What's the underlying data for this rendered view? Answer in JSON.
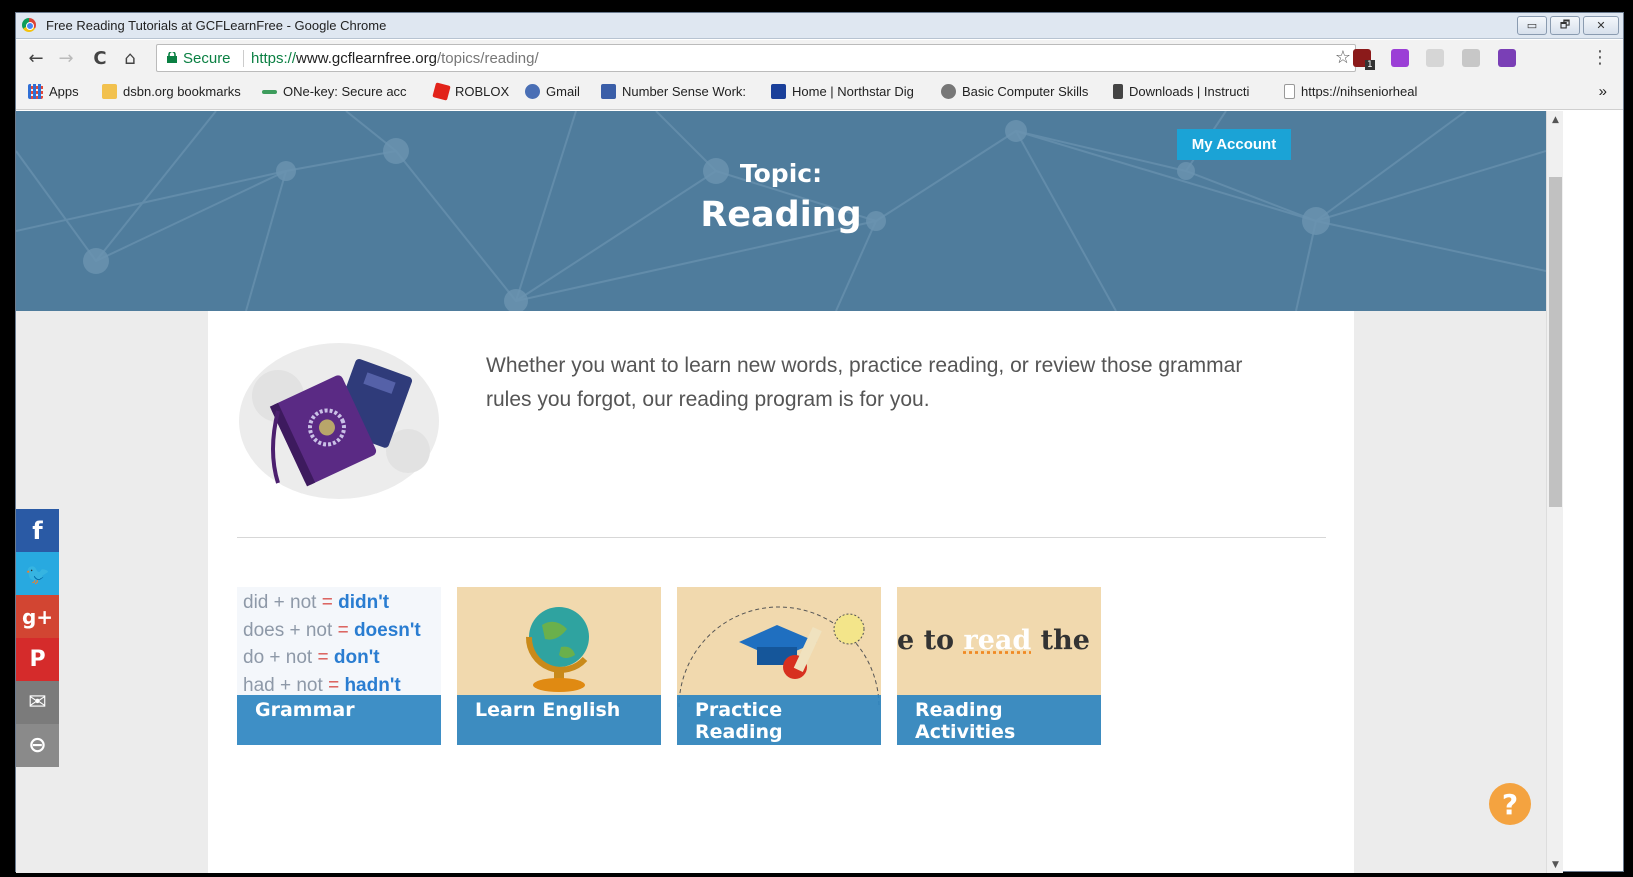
{
  "browser": {
    "window_title": "Free Reading Tutorials at GCFLearnFree - Google Chrome",
    "secure_label": "Secure",
    "url_scheme": "https://",
    "url_host": "www.gcflearnfree.org",
    "url_path": "/topics/reading/",
    "buttons": {
      "back": "←",
      "forward": "→",
      "reload": "C",
      "home": "⌂",
      "star": "☆",
      "menu": "⋮",
      "minimize": "▭",
      "restore": "🗗",
      "close": "✕",
      "more_bookmarks": "»"
    },
    "extension_badge": "1"
  },
  "bookmarks": [
    {
      "label": "Apps",
      "icon": "apps-grid-icon",
      "color": "#2f6fd6"
    },
    {
      "label": "dsbn.org bookmarks",
      "icon": "folder-icon",
      "color": "#f2c14e"
    },
    {
      "label": "ONe-key: Secure acc",
      "icon": "onekey-icon",
      "color": "#3d9c5c"
    },
    {
      "label": "ROBLOX",
      "icon": "roblox-icon",
      "color": "#e2231a"
    },
    {
      "label": "Gmail",
      "icon": "gmail-icon",
      "color": "#4a6fb5"
    },
    {
      "label": "Number Sense Work:",
      "icon": "m-icon",
      "color": "#3a5ea8"
    },
    {
      "label": "Home | Northstar Dig",
      "icon": "northstar-icon",
      "color": "#1a3f9a"
    },
    {
      "label": "Basic Computer Skills",
      "icon": "gcf-icon",
      "color": "#777777"
    },
    {
      "label": "Downloads | Instructi",
      "icon": "downloads-icon",
      "color": "#444444"
    },
    {
      "label": "https://nihseniorheal",
      "icon": "page-icon",
      "color": "#999999"
    }
  ],
  "page": {
    "account_button": "My Account",
    "topic_label": "Topic:",
    "topic_name": "Reading",
    "intro": "Whether you want to learn new words, practice reading, or review those grammar rules you forgot, our reading program is for you.",
    "grammar_lines": [
      {
        "a": "did + not",
        "eq": "=",
        "b": "didn't"
      },
      {
        "a": "does + not",
        "eq": "=",
        "b": "doesn't"
      },
      {
        "a": "do + not",
        "eq": "=",
        "b": "don't"
      },
      {
        "a": "had + not",
        "eq": "=",
        "b": "hadn't"
      }
    ],
    "reading_banner": {
      "pre": "e to",
      "mid": "read",
      "post": "the"
    },
    "cards": [
      {
        "label": "Grammar"
      },
      {
        "label": "Learn English"
      },
      {
        "label": "Practice Reading"
      },
      {
        "label": "Reading Activities"
      }
    ],
    "social": [
      {
        "name": "facebook",
        "glyph": "f",
        "color": "#2a5aa5"
      },
      {
        "name": "twitter",
        "glyph": "🐦",
        "color": "#28a9e0"
      },
      {
        "name": "google-plus",
        "glyph": "g+",
        "color": "#d24532"
      },
      {
        "name": "pinterest",
        "glyph": "P",
        "color": "#d52b2b"
      },
      {
        "name": "email",
        "glyph": "✉",
        "color": "#7b7b7b"
      },
      {
        "name": "link",
        "glyph": "⊖",
        "color": "#8a8a8a"
      }
    ],
    "help_glyph": "?"
  },
  "colors": {
    "hero": "#4f7c9c",
    "accent": "#1ba3d6",
    "card_label": "#2e86c1",
    "help": "#f4a340"
  }
}
